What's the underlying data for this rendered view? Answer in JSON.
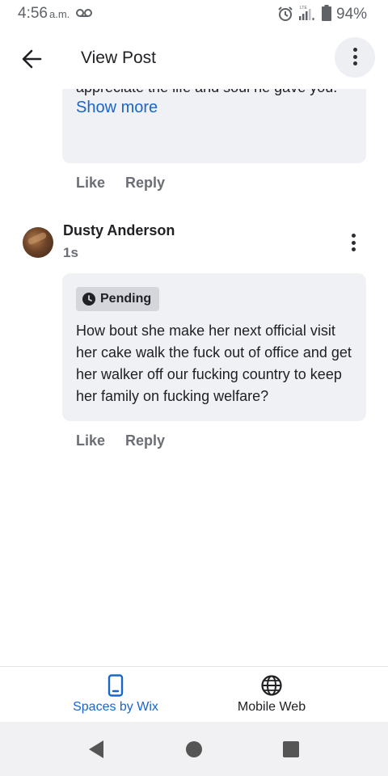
{
  "status_bar": {
    "time": "4:56",
    "ampm": "a.m.",
    "lte_label": "LTE",
    "battery_percent": "94%",
    "icons": [
      "voicemail-icon",
      "alarm-icon",
      "signal-icon",
      "battery-icon"
    ]
  },
  "header": {
    "back_icon": "arrow-left-icon",
    "title": "View Post",
    "more_icon": "more-vertical-icon"
  },
  "previous_comment": {
    "visible_text": "appreciate the life and soul he gave you.",
    "show_more_label": "Show more",
    "like_label": "Like",
    "reply_label": "Reply"
  },
  "comment": {
    "author": "Dusty Anderson",
    "timestamp": "1s",
    "status_badge": "Pending",
    "text": "How bout she make her next official visit her cake walk the fuck out of office and get her walker off our fucking country to keep her family on fucking welfare?",
    "like_label": "Like",
    "reply_label": "Reply"
  },
  "bottom_nav": {
    "items": [
      {
        "label": "Spaces by Wix",
        "icon": "phone-icon",
        "active": true
      },
      {
        "label": "Mobile Web",
        "icon": "globe-icon",
        "active": false
      }
    ]
  },
  "colors": {
    "accent": "#1a65c8",
    "bubble_bg": "#f0f1f5",
    "badge_bg": "#d5d6dc",
    "muted_text": "#6b6e75"
  }
}
